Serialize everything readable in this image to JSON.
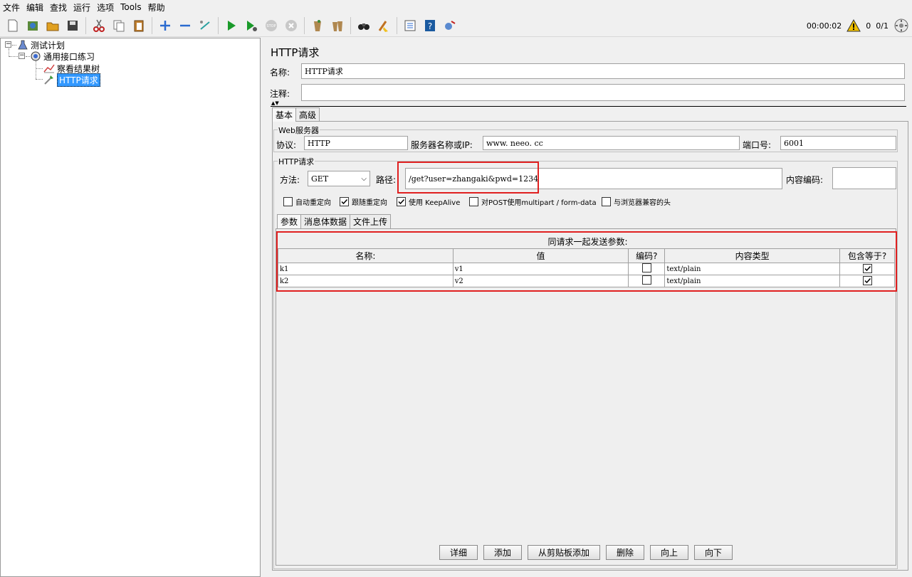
{
  "menu": [
    "文件",
    "编辑",
    "查找",
    "运行",
    "选项",
    "Tools",
    "帮助"
  ],
  "toolbar_icons": [
    "new-icon",
    "templates-icon",
    "open-icon",
    "save-icon",
    "cut-icon",
    "copy-icon",
    "paste-icon",
    "expand-icon",
    "collapse-icon",
    "toggle-icon",
    "start-icon",
    "start-no-pause-icon",
    "stop-icon",
    "shutdown-icon",
    "clear-icon",
    "clear-all-icon",
    "search-icon",
    "reset-search-icon",
    "function-helper-icon",
    "help-icon",
    "remote-icon"
  ],
  "status": {
    "elapsed": "00:00:02",
    "warnings": "0",
    "threads": "0/1"
  },
  "tree": {
    "plan": "测试计划",
    "thread_group": "通用接口练习",
    "result_tree": "察看结果树",
    "http_request": "HTTP请求"
  },
  "panel": {
    "title": "HTTP请求",
    "name_label": "名称:",
    "name_value": "HTTP请求",
    "comment_label": "注释:",
    "comment_value": "",
    "tabs": [
      "基本",
      "高级"
    ],
    "web_server": {
      "title": "Web服务器",
      "protocol_label": "协议:",
      "protocol_value": "HTTP",
      "server_label": "服务器名称或IP:",
      "server_value": "www. neeo. cc",
      "port_label": "端口号:",
      "port_value": "6001"
    },
    "http_request": {
      "title": "HTTP请求",
      "method_label": "方法:",
      "method_value": "GET",
      "path_label": "路径:",
      "path_value": "/get?user=zhangaki&pwd=1234",
      "encoding_label": "内容编码:",
      "encoding_value": ""
    },
    "options": [
      {
        "label": "自动重定向",
        "checked": false
      },
      {
        "label": "跟随重定向",
        "checked": true
      },
      {
        "label": "使用 KeepAlive",
        "checked": true
      },
      {
        "label": "对POST使用multipart / form-data",
        "checked": false
      },
      {
        "label": "与浏览器兼容的头",
        "checked": false
      }
    ],
    "subtabs": [
      "参数",
      "消息体数据",
      "文件上传"
    ],
    "params_caption": "同请求一起发送参数:",
    "columns": [
      "名称:",
      "值",
      "编码?",
      "内容类型",
      "包含等于?"
    ],
    "rows": [
      {
        "name": "k1",
        "value": "v1",
        "encode": false,
        "content_type": "text/plain",
        "include_equals": true
      },
      {
        "name": "k2",
        "value": "v2",
        "encode": false,
        "content_type": "text/plain",
        "include_equals": true
      }
    ],
    "buttons": [
      "详细",
      "添加",
      "从剪贴板添加",
      "删除",
      "向上",
      "向下"
    ]
  }
}
